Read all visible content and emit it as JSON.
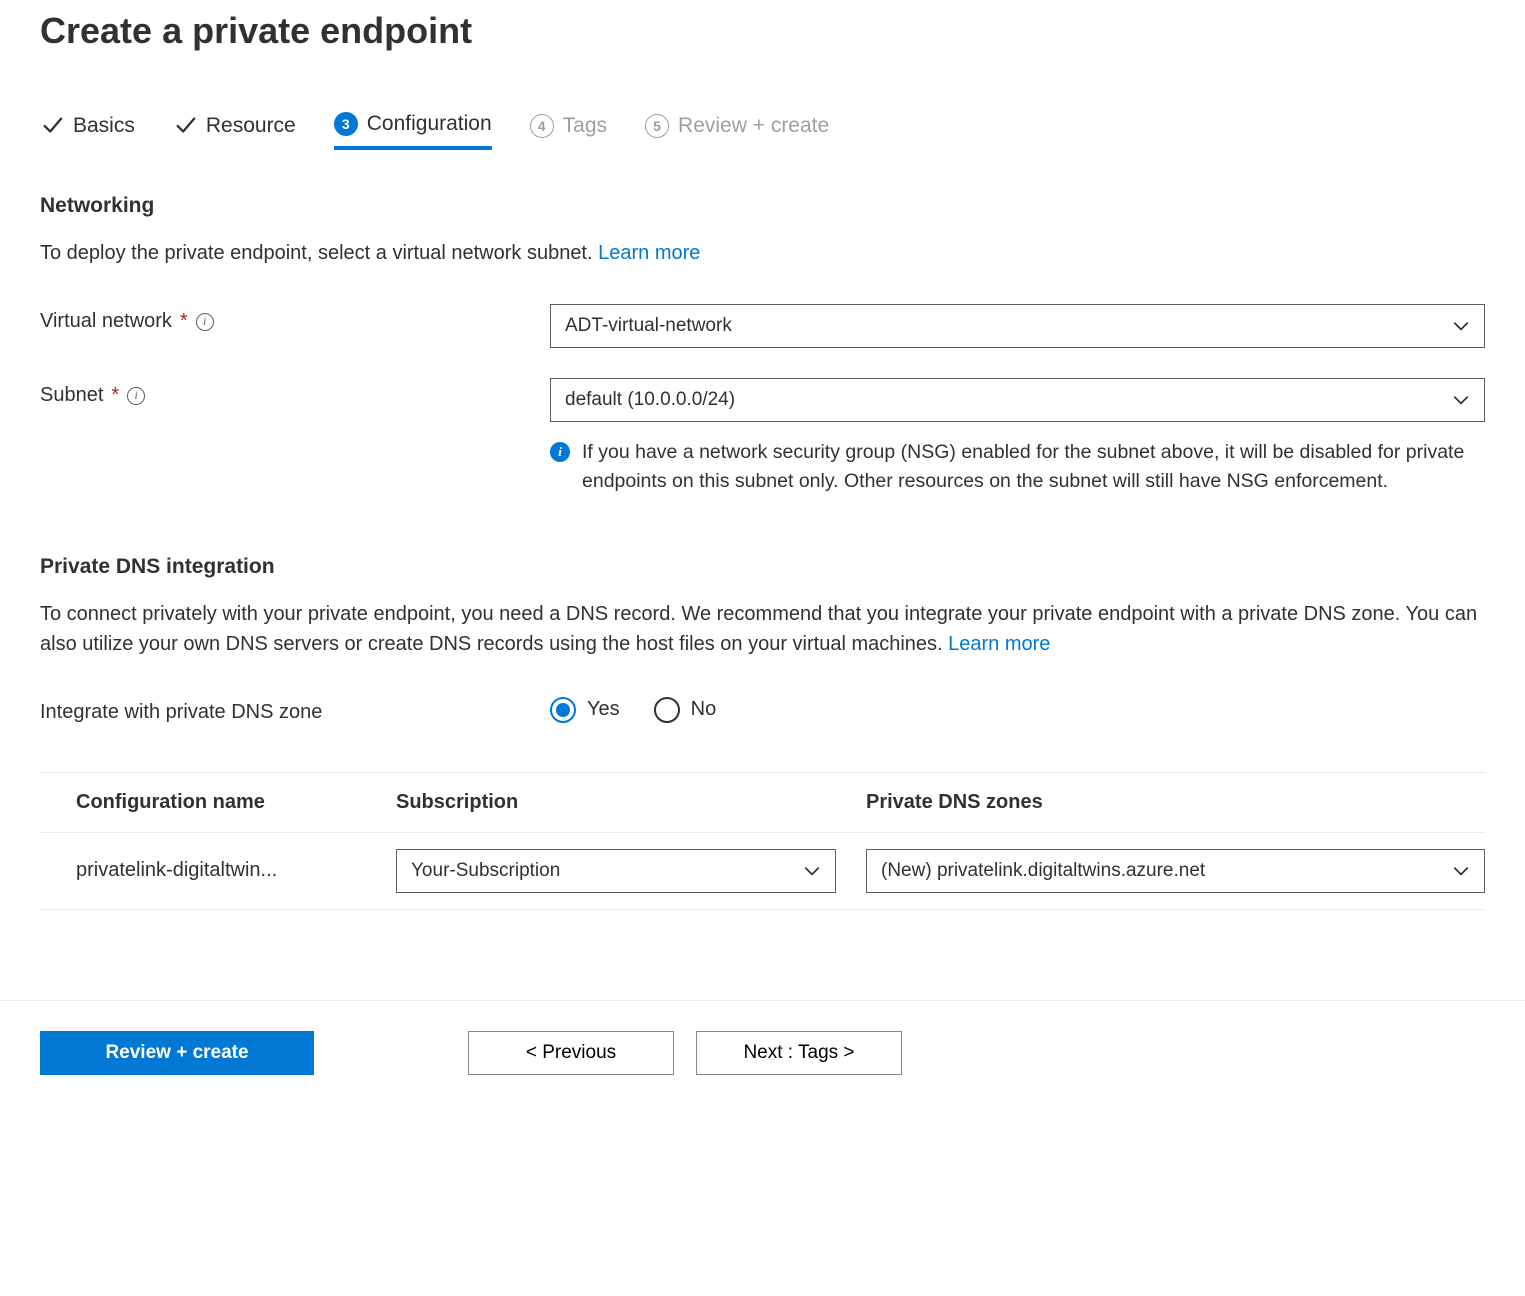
{
  "page_title": "Create a private endpoint",
  "tabs": {
    "t1": {
      "label": "Basics"
    },
    "t2": {
      "label": "Resource"
    },
    "t3": {
      "number": "3",
      "label": "Configuration"
    },
    "t4": {
      "number": "4",
      "label": "Tags"
    },
    "t5": {
      "number": "5",
      "label": "Review + create"
    }
  },
  "networking": {
    "title": "Networking",
    "desc": "To deploy the private endpoint, select a virtual network subnet.  ",
    "learn_more": "Learn more",
    "vnet_label": "Virtual network",
    "vnet_value": "ADT-virtual-network",
    "subnet_label": "Subnet",
    "subnet_value": "default (10.0.0.0/24)",
    "nsg_note": "If you have a network security group (NSG) enabled for the subnet above, it will be disabled for private endpoints on this subnet only. Other resources on the subnet will still have NSG enforcement."
  },
  "dns": {
    "title": "Private DNS integration",
    "desc": "To connect privately with your private endpoint, you need a DNS record. We recommend that you integrate your private endpoint with a private DNS zone. You can also utilize your own DNS servers or create DNS records using the host files on your virtual machines.  ",
    "learn_more": "Learn more",
    "integrate_label": "Integrate with private DNS zone",
    "yes": "Yes",
    "no": "No"
  },
  "dns_table": {
    "col1": "Configuration name",
    "col2": "Subscription",
    "col3": "Private DNS zones",
    "row1": {
      "cfg": "privatelink-digitaltwin...",
      "sub": "Your-Subscription",
      "zone": "(New) privatelink.digitaltwins.azure.net"
    }
  },
  "footer": {
    "review": "Review + create",
    "prev": "< Previous",
    "next": "Next : Tags >"
  }
}
